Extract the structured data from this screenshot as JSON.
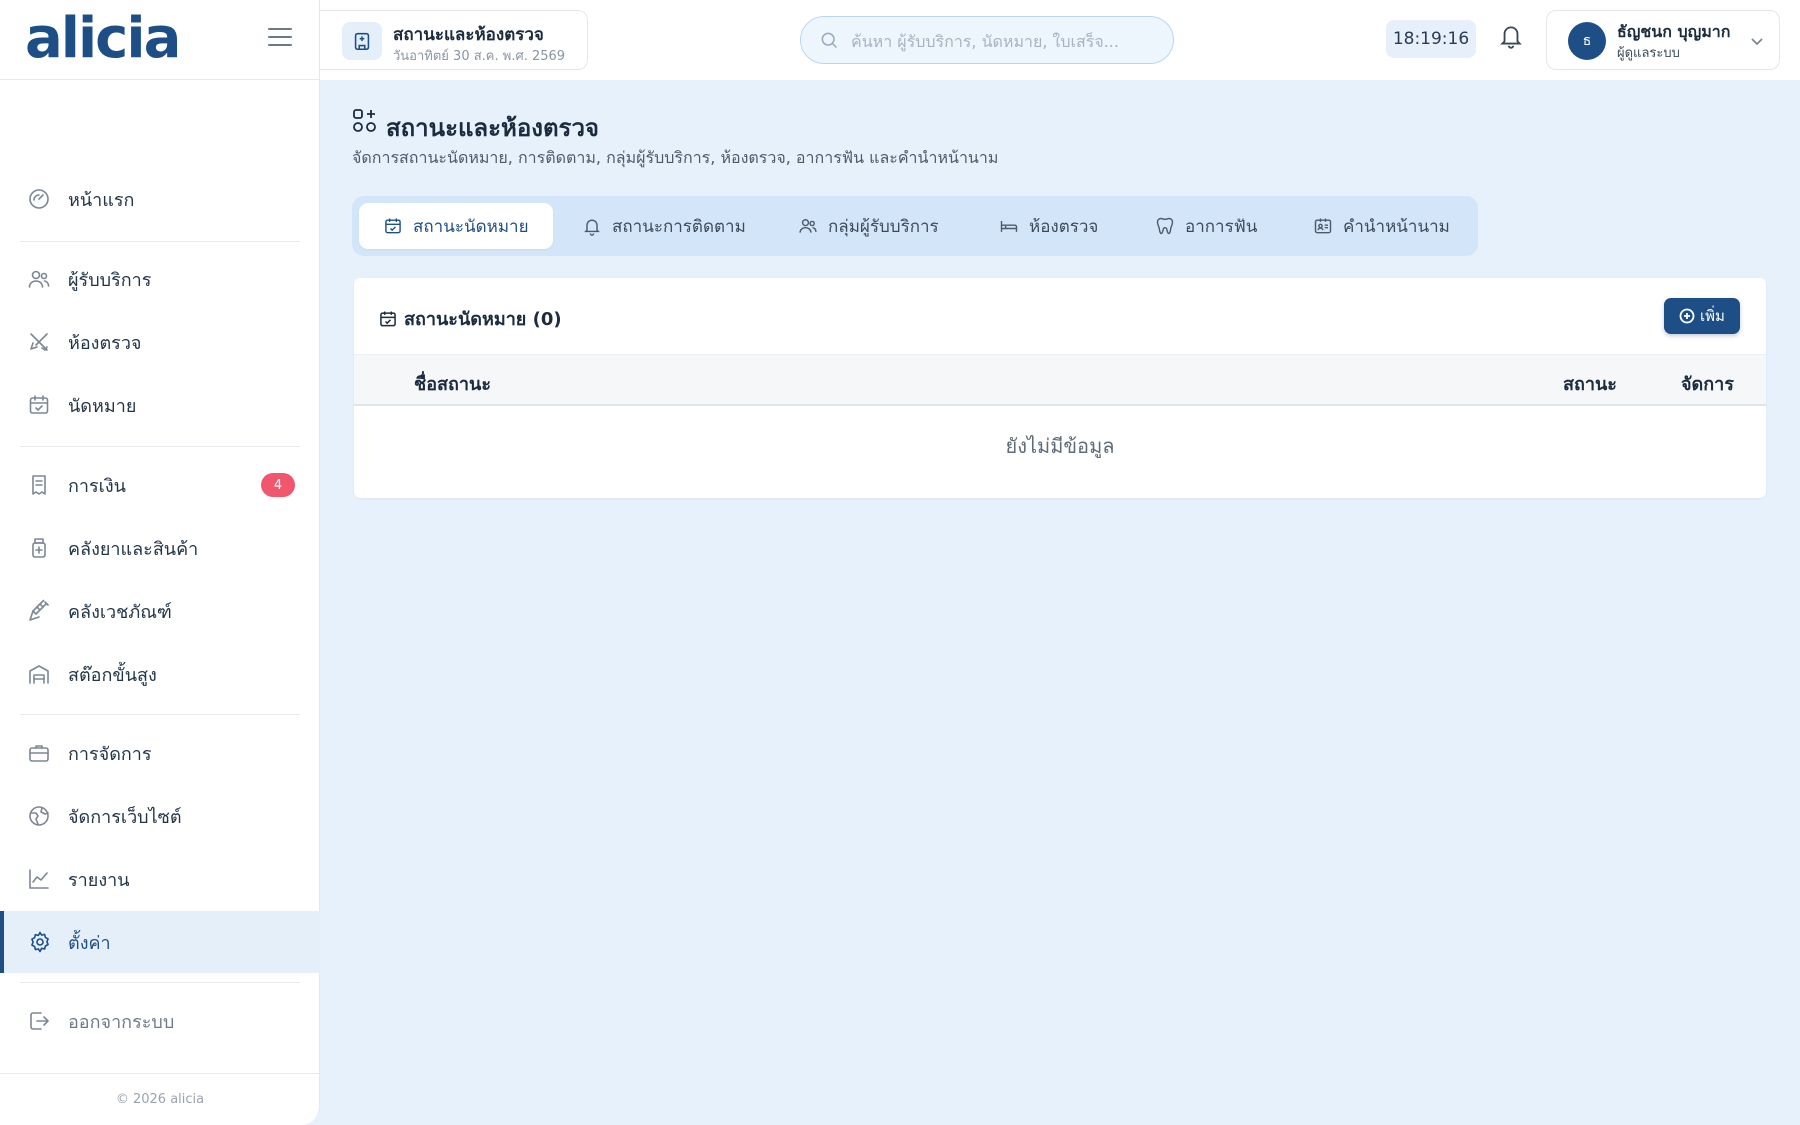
{
  "app": {
    "logo": "alicia",
    "footer": "© 2026 alicia"
  },
  "sidebar": {
    "items": [
      {
        "label": "หน้าแรก",
        "icon": "dashboard-icon"
      },
      {
        "label": "ผู้รับบริการ",
        "icon": "users-icon"
      },
      {
        "label": "ห้องตรวจ",
        "icon": "tools-icon"
      },
      {
        "label": "นัดหมาย",
        "icon": "calendar-icon"
      },
      {
        "label": "การเงิน",
        "icon": "receipt-icon",
        "badge": "4"
      },
      {
        "label": "คลังยาและสินค้า",
        "icon": "medicine-icon"
      },
      {
        "label": "คลังเวชภัณฑ์",
        "icon": "syringe-icon"
      },
      {
        "label": "สต๊อกขั้นสูง",
        "icon": "warehouse-icon"
      },
      {
        "label": "การจัดการ",
        "icon": "briefcase-icon"
      },
      {
        "label": "จัดการเว็บไซต์",
        "icon": "globe-icon"
      },
      {
        "label": "รายงาน",
        "icon": "chart-icon"
      },
      {
        "label": "ตั้งค่า",
        "icon": "gear-icon",
        "active": true
      },
      {
        "label": "ออกจากระบบ",
        "icon": "logout-icon"
      }
    ]
  },
  "topbar": {
    "page_title": "สถานะและห้องตรวจ",
    "date": "วันอาทิตย์ 30 ส.ค. พ.ศ. 2569",
    "search_placeholder": "ค้นหา ผู้รับบริการ, นัดหมาย, ใบเสร็จ...",
    "clock": "18:19:16",
    "user_initial": "ธ",
    "user_name": "ธัญชนก บุญมาก",
    "user_role": "ผู้ดูแลระบบ"
  },
  "main": {
    "title": "สถานะและห้องตรวจ",
    "subtitle": "จัดการสถานะนัดหมาย, การติดตาม, กลุ่มผู้รับบริการ, ห้องตรวจ, อาการฟัน และคำนำหน้านาม",
    "tabs": [
      {
        "label": "สถานะนัดหมาย",
        "icon": "calendar-check-icon",
        "active": true
      },
      {
        "label": "สถานะการติดตาม",
        "icon": "bell-icon"
      },
      {
        "label": "กลุ่มผู้รับบริการ",
        "icon": "users-icon"
      },
      {
        "label": "ห้องตรวจ",
        "icon": "bed-icon"
      },
      {
        "label": "อาการฟัน",
        "icon": "tooth-icon"
      },
      {
        "label": "คำนำหน้านาม",
        "icon": "id-card-icon"
      }
    ],
    "card": {
      "title": "สถานะนัดหมาย (0)",
      "add_label": "เพิ่ม",
      "columns": [
        "ชื่อสถานะ",
        "สถานะ",
        "จัดการ"
      ],
      "empty_text": "ยังไม่มีข้อมูล"
    }
  }
}
